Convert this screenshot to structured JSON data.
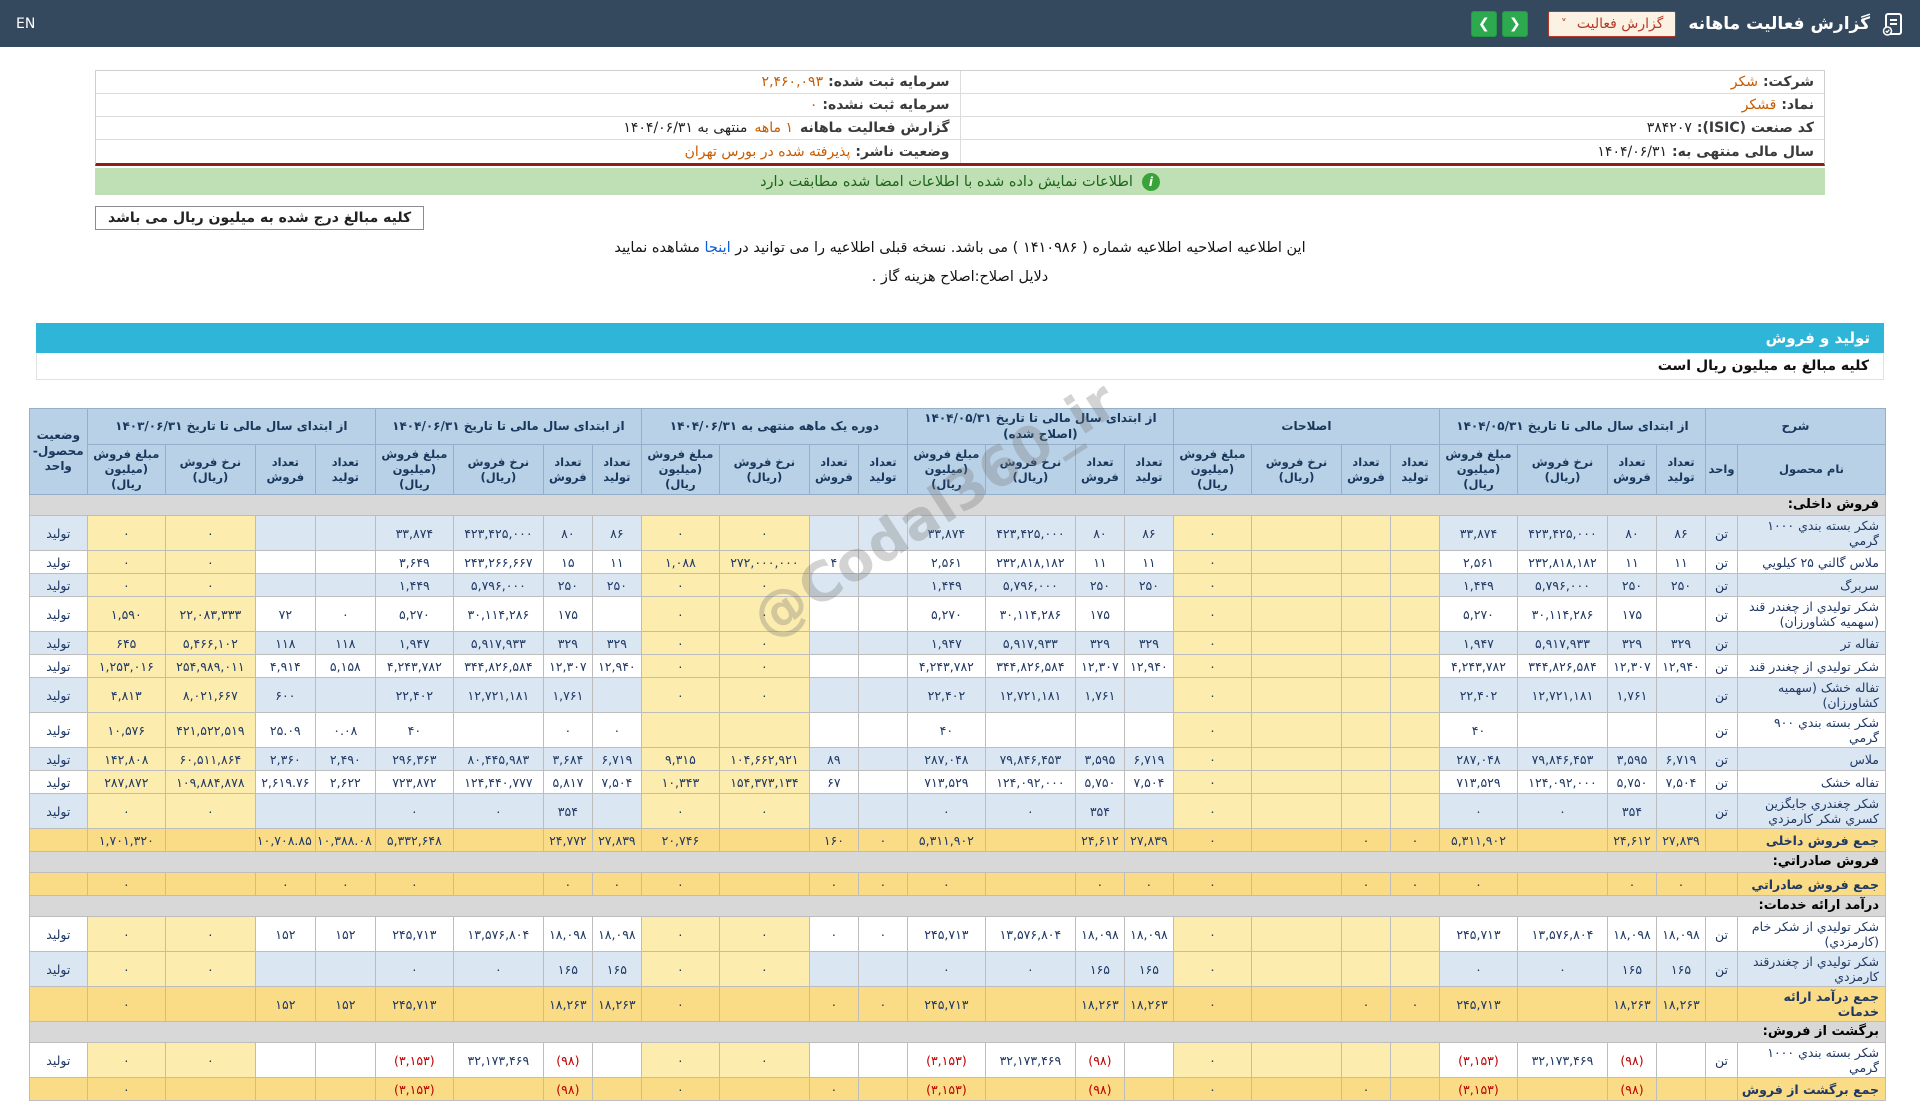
{
  "topbar": {
    "title": "گزارش فعالیت ماهانه",
    "dropdown_label": "گزارش فعالیت",
    "en": "EN",
    "icons": {
      "prev": "❮",
      "next": "❯",
      "caret": "˅",
      "info": "i"
    }
  },
  "info": {
    "company_label": "شرکت:",
    "company_value": "شکر",
    "symbol_label": "نماد:",
    "symbol_value": "قشکر",
    "isic_label": "کد صنعت (ISIC):",
    "isic_value": "۳۸۴۲۰۷",
    "fiscal_label": "سال مالی منتهی به:",
    "fiscal_value": "۱۴۰۴/۰۶/۳۱",
    "registered_capital_label": "سرمایه ثبت شده:",
    "registered_capital_value": "۲,۴۶۰,۰۹۳",
    "unregistered_capital_label": "سرمایه ثبت نشده:",
    "unregistered_capital_value": "۰",
    "report_period_label": "گزارش فعالیت ماهانه",
    "report_period_mid": "۱ ماهه",
    "report_period_tail": "منتهی به ۱۴۰۴/۰۶/۳۱",
    "issuer_status_label": "وضعیت ناشر:",
    "issuer_status_value": "پذیرفته شده در بورس تهران"
  },
  "banner": {
    "icon": "i",
    "text": "اطلاعات نمایش داده شده با اطلاعات امضا شده مطابقت دارد"
  },
  "amounts_box": "کلیه مبالغ درج شده به میلیون ریال می باشد",
  "notice": {
    "pre": "این اطلاعیه اصلاحیه اطلاعیه شماره ( ۱۴۱۰۹۸۶ ) می باشد. نسخه قبلی اطلاعیه را می توانید در",
    "link": "اینجا",
    "post": "مشاهده نمایید",
    "reason": "دلایل اصلاح:اصلاح هزینه گاز ."
  },
  "section": {
    "title": "تولید و فروش",
    "note": "کلیه مبالغ به میلیون ریال است"
  },
  "watermark": "@Codal360_ir",
  "table": {
    "corner": "شرح",
    "name_header": "نام محصول",
    "unit_header": "واحد",
    "status_header": "وضعیت محصول-واحد",
    "sub_labels": [
      "تعداد تولید",
      "تعداد فروش",
      "نرخ فروش (ریال)",
      "مبلغ فروش (میلیون ریال)"
    ],
    "groups": [
      "از ابتدای سال مالی تا تاریخ ۱۴۰۴/۰۵/۳۱",
      "اصلاحات",
      "از ابتدای سال مالی تا تاریخ ۱۴۰۴/۰۵/۳۱ (اصلاح شده)",
      "دوره یک ماهه منتهی به ۱۴۰۴/۰۶/۳۱",
      "از ابتدای سال مالی تا تاریخ ۱۴۰۴/۰۶/۳۱",
      "از ابتدای سال مالی تا تاریخ ۱۴۰۳/۰۶/۳۱"
    ],
    "rows": [
      {
        "type": "section",
        "label": "فروش داخلی:"
      },
      {
        "type": "product",
        "name": "شکر بسته بندي ۱۰۰۰ گرمي",
        "unit": "تن",
        "status": "تولید",
        "g1": [
          "۸۶",
          "۸۰",
          "۴۲۳,۴۲۵,۰۰۰",
          "۳۳,۸۷۴"
        ],
        "g2": [
          "",
          "",
          "",
          "۰"
        ],
        "g3": [
          "۸۶",
          "۸۰",
          "۴۲۳,۴۲۵,۰۰۰",
          "۳۳,۸۷۴"
        ],
        "g4": [
          "",
          "",
          "۰",
          "۰"
        ],
        "g5": [
          "۸۶",
          "۸۰",
          "۴۲۳,۴۲۵,۰۰۰",
          "۳۳,۸۷۴"
        ],
        "g6": [
          "",
          "",
          "۰",
          "۰"
        ]
      },
      {
        "type": "product",
        "name": "ملاس گالني ۲۵ کيلويي",
        "unit": "تن",
        "status": "تولید",
        "g1": [
          "۱۱",
          "۱۱",
          "۲۳۲,۸۱۸,۱۸۲",
          "۲,۵۶۱"
        ],
        "g2": [
          "",
          "",
          "",
          "۰"
        ],
        "g3": [
          "۱۱",
          "۱۱",
          "۲۳۲,۸۱۸,۱۸۲",
          "۲,۵۶۱"
        ],
        "g4": [
          "",
          "۴",
          "۲۷۲,۰۰۰,۰۰۰",
          "۱,۰۸۸"
        ],
        "g5": [
          "۱۱",
          "۱۵",
          "۲۴۳,۲۶۶,۶۶۷",
          "۳,۶۴۹"
        ],
        "g6": [
          "",
          "",
          "۰",
          "۰"
        ]
      },
      {
        "type": "product",
        "name": "سربرگ",
        "unit": "تن",
        "status": "تولید",
        "g1": [
          "۲۵۰",
          "۲۵۰",
          "۵,۷۹۶,۰۰۰",
          "۱,۴۴۹"
        ],
        "g2": [
          "",
          "",
          "",
          "۰"
        ],
        "g3": [
          "۲۵۰",
          "۲۵۰",
          "۵,۷۹۶,۰۰۰",
          "۱,۴۴۹"
        ],
        "g4": [
          "",
          "",
          "۰",
          "۰"
        ],
        "g5": [
          "۲۵۰",
          "۲۵۰",
          "۵,۷۹۶,۰۰۰",
          "۱,۴۴۹"
        ],
        "g6": [
          "",
          "",
          "۰",
          "۰"
        ]
      },
      {
        "type": "product",
        "name": "شکر توليدي از چغندر قند (سهميه کشاورزان)",
        "unit": "تن",
        "status": "تولید",
        "g1": [
          "",
          "۱۷۵",
          "۳۰,۱۱۴,۲۸۶",
          "۵,۲۷۰"
        ],
        "g2": [
          "",
          "",
          "",
          "۰"
        ],
        "g3": [
          "",
          "۱۷۵",
          "۳۰,۱۱۴,۲۸۶",
          "۵,۲۷۰"
        ],
        "g4": [
          "",
          "",
          "۰",
          "۰"
        ],
        "g5": [
          "",
          "۱۷۵",
          "۳۰,۱۱۴,۲۸۶",
          "۵,۲۷۰"
        ],
        "g6": [
          "۰",
          "۷۲",
          "۲۲,۰۸۳,۳۳۳",
          "۱,۵۹۰"
        ]
      },
      {
        "type": "product",
        "name": "تفاله تر",
        "unit": "تن",
        "status": "تولید",
        "g1": [
          "۳۲۹",
          "۳۲۹",
          "۵,۹۱۷,۹۳۳",
          "۱,۹۴۷"
        ],
        "g2": [
          "",
          "",
          "",
          "۰"
        ],
        "g3": [
          "۳۲۹",
          "۳۲۹",
          "۵,۹۱۷,۹۳۳",
          "۱,۹۴۷"
        ],
        "g4": [
          "",
          "",
          "۰",
          "۰"
        ],
        "g5": [
          "۳۲۹",
          "۳۲۹",
          "۵,۹۱۷,۹۳۳",
          "۱,۹۴۷"
        ],
        "g6": [
          "۱۱۸",
          "۱۱۸",
          "۵,۴۶۶,۱۰۲",
          "۶۴۵"
        ]
      },
      {
        "type": "product",
        "name": "شکر توليدي از چغندر قند",
        "unit": "تن",
        "status": "تولید",
        "g1": [
          "۱۲,۹۴۰",
          "۱۲,۳۰۷",
          "۳۴۴,۸۲۶,۵۸۴",
          "۴,۲۴۳,۷۸۲"
        ],
        "g2": [
          "",
          "",
          "",
          "۰"
        ],
        "g3": [
          "۱۲,۹۴۰",
          "۱۲,۳۰۷",
          "۳۴۴,۸۲۶,۵۸۴",
          "۴,۲۴۳,۷۸۲"
        ],
        "g4": [
          "",
          "",
          "۰",
          "۰"
        ],
        "g5": [
          "۱۲,۹۴۰",
          "۱۲,۳۰۷",
          "۳۴۴,۸۲۶,۵۸۴",
          "۴,۲۴۳,۷۸۲"
        ],
        "g6": [
          "۵,۱۵۸",
          "۴,۹۱۴",
          "۲۵۴,۹۸۹,۰۱۱",
          "۱,۲۵۳,۰۱۶"
        ]
      },
      {
        "type": "product",
        "name": "تفاله خشک (سهميه کشاورزان)",
        "unit": "تن",
        "status": "تولید",
        "g1": [
          "",
          "۱,۷۶۱",
          "۱۲,۷۲۱,۱۸۱",
          "۲۲,۴۰۲"
        ],
        "g2": [
          "",
          "",
          "",
          "۰"
        ],
        "g3": [
          "",
          "۱,۷۶۱",
          "۱۲,۷۲۱,۱۸۱",
          "۲۲,۴۰۲"
        ],
        "g4": [
          "",
          "",
          "۰",
          "۰"
        ],
        "g5": [
          "",
          "۱,۷۶۱",
          "۱۲,۷۲۱,۱۸۱",
          "۲۲,۴۰۲"
        ],
        "g6": [
          "",
          "۶۰۰",
          "۸,۰۲۱,۶۶۷",
          "۴,۸۱۳"
        ]
      },
      {
        "type": "product",
        "name": "شکر بسته بندي ۹۰۰ گرمي",
        "unit": "تن",
        "status": "تولید",
        "g1": [
          "",
          "",
          "",
          "۴۰"
        ],
        "g2": [
          "",
          "",
          "",
          "۰"
        ],
        "g3": [
          "",
          "",
          "",
          "۴۰"
        ],
        "g4": [
          "",
          "",
          "",
          ""
        ],
        "g5": [
          "۰",
          "۰",
          "",
          "۴۰"
        ],
        "g6": [
          "۰.۰۸",
          "۲۵.۰۹",
          "۴۲۱,۵۲۲,۵۱۹",
          "۱۰,۵۷۶"
        ]
      },
      {
        "type": "product",
        "name": "ملاس",
        "unit": "تن",
        "status": "تولید",
        "g1": [
          "۶,۷۱۹",
          "۳,۵۹۵",
          "۷۹,۸۴۶,۴۵۳",
          "۲۸۷,۰۴۸"
        ],
        "g2": [
          "",
          "",
          "",
          "۰"
        ],
        "g3": [
          "۶,۷۱۹",
          "۳,۵۹۵",
          "۷۹,۸۴۶,۴۵۳",
          "۲۸۷,۰۴۸"
        ],
        "g4": [
          "",
          "۸۹",
          "۱۰۴,۶۶۲,۹۲۱",
          "۹,۳۱۵"
        ],
        "g5": [
          "۶,۷۱۹",
          "۳,۶۸۴",
          "۸۰,۴۴۵,۹۸۳",
          "۲۹۶,۳۶۳"
        ],
        "g6": [
          "۲,۴۹۰",
          "۲,۳۶۰",
          "۶۰,۵۱۱,۸۶۴",
          "۱۴۲,۸۰۸"
        ]
      },
      {
        "type": "product",
        "name": "تفاله خشک",
        "unit": "تن",
        "status": "تولید",
        "g1": [
          "۷,۵۰۴",
          "۵,۷۵۰",
          "۱۲۴,۰۹۲,۰۰۰",
          "۷۱۳,۵۲۹"
        ],
        "g2": [
          "",
          "",
          "",
          "۰"
        ],
        "g3": [
          "۷,۵۰۴",
          "۵,۷۵۰",
          "۱۲۴,۰۹۲,۰۰۰",
          "۷۱۳,۵۲۹"
        ],
        "g4": [
          "",
          "۶۷",
          "۱۵۴,۳۷۳,۱۳۴",
          "۱۰,۳۴۳"
        ],
        "g5": [
          "۷,۵۰۴",
          "۵,۸۱۷",
          "۱۲۴,۴۴۰,۷۷۷",
          "۷۲۳,۸۷۲"
        ],
        "g6": [
          "۲,۶۲۲",
          "۲,۶۱۹.۷۶",
          "۱۰۹,۸۸۴,۸۷۸",
          "۲۸۷,۸۷۲"
        ]
      },
      {
        "type": "product",
        "name": "شکر چغندري جايگزين کسري شکر کارمزدي",
        "unit": "تن",
        "status": "تولید",
        "g1": [
          "",
          "۳۵۴",
          "۰",
          "۰"
        ],
        "g2": [
          "",
          "",
          "",
          "۰"
        ],
        "g3": [
          "",
          "۳۵۴",
          "۰",
          "۰"
        ],
        "g4": [
          "",
          "",
          "۰",
          "۰"
        ],
        "g5": [
          "",
          "۳۵۴",
          "۰",
          "۰"
        ],
        "g6": [
          "",
          "",
          "۰",
          "۰"
        ]
      },
      {
        "type": "total",
        "name": "جمع فروش داخلی",
        "g1": [
          "۲۷,۸۳۹",
          "۲۴,۶۱۲",
          "",
          "۵,۳۱۱,۹۰۲"
        ],
        "g2": [
          "۰",
          "۰",
          "",
          "۰"
        ],
        "g3": [
          "۲۷,۸۳۹",
          "۲۴,۶۱۲",
          "",
          "۵,۳۱۱,۹۰۲"
        ],
        "g4": [
          "۰",
          "۱۶۰",
          "",
          "۲۰,۷۴۶"
        ],
        "g5": [
          "۲۷,۸۳۹",
          "۲۴,۷۷۲",
          "",
          "۵,۳۳۲,۶۴۸"
        ],
        "g6": [
          "۱۰,۳۸۸.۰۸",
          "۱۰,۷۰۸.۸۵",
          "",
          "۱,۷۰۱,۳۲۰"
        ]
      },
      {
        "type": "section",
        "label": "فروش صادراتي:"
      },
      {
        "type": "total",
        "name": "جمع فروش صادراتي",
        "g1": [
          "۰",
          "۰",
          "",
          "۰"
        ],
        "g2": [
          "۰",
          "۰",
          "",
          "۰"
        ],
        "g3": [
          "۰",
          "۰",
          "",
          "۰"
        ],
        "g4": [
          "۰",
          "۰",
          "",
          "۰"
        ],
        "g5": [
          "۰",
          "۰",
          "",
          "۰"
        ],
        "g6": [
          "۰",
          "۰",
          "",
          "۰"
        ]
      },
      {
        "type": "section",
        "label": "درآمد ارائه خدمات:"
      },
      {
        "type": "product",
        "name": "شکر توليدي از شکر خام (کارمزدي)",
        "unit": "تن",
        "status": "تولید",
        "g1": [
          "۱۸,۰۹۸",
          "۱۸,۰۹۸",
          "۱۳,۵۷۶,۸۰۴",
          "۲۴۵,۷۱۳"
        ],
        "g2": [
          "",
          "",
          "",
          "۰"
        ],
        "g3": [
          "۱۸,۰۹۸",
          "۱۸,۰۹۸",
          "۱۳,۵۷۶,۸۰۴",
          "۲۴۵,۷۱۳"
        ],
        "g4": [
          "۰",
          "۰",
          "۰",
          "۰"
        ],
        "g5": [
          "۱۸,۰۹۸",
          "۱۸,۰۹۸",
          "۱۳,۵۷۶,۸۰۴",
          "۲۴۵,۷۱۳"
        ],
        "g6": [
          "۱۵۲",
          "۱۵۲",
          "۰",
          "۰"
        ]
      },
      {
        "type": "product",
        "name": "شکر توليدي از چغندرقند کارمزدي",
        "unit": "تن",
        "status": "تولید",
        "g1": [
          "۱۶۵",
          "۱۶۵",
          "۰",
          "۰"
        ],
        "g2": [
          "",
          "",
          "",
          "۰"
        ],
        "g3": [
          "۱۶۵",
          "۱۶۵",
          "۰",
          "۰"
        ],
        "g4": [
          "",
          "",
          "۰",
          "۰"
        ],
        "g5": [
          "۱۶۵",
          "۱۶۵",
          "۰",
          "۰"
        ],
        "g6": [
          "",
          "",
          "۰",
          "۰"
        ]
      },
      {
        "type": "total",
        "name": "جمع درآمد ارائه خدمات",
        "g1": [
          "۱۸,۲۶۳",
          "۱۸,۲۶۳",
          "",
          "۲۴۵,۷۱۳"
        ],
        "g2": [
          "۰",
          "۰",
          "",
          "۰"
        ],
        "g3": [
          "۱۸,۲۶۳",
          "۱۸,۲۶۳",
          "",
          "۲۴۵,۷۱۳"
        ],
        "g4": [
          "۰",
          "۰",
          "",
          "۰"
        ],
        "g5": [
          "۱۸,۲۶۳",
          "۱۸,۲۶۳",
          "",
          "۲۴۵,۷۱۳"
        ],
        "g6": [
          "۱۵۲",
          "۱۵۲",
          "",
          "۰"
        ]
      },
      {
        "type": "section",
        "label": "برگشت از فروش:"
      },
      {
        "type": "product",
        "name": "شکر بسته بندي ۱۰۰۰ گرمي",
        "unit": "تن",
        "status": "تولید",
        "g1": [
          "",
          "(۹۸)",
          "۳۲,۱۷۳,۴۶۹",
          "(۳,۱۵۳)"
        ],
        "g2": [
          "",
          "",
          "",
          "۰"
        ],
        "g3": [
          "",
          "(۹۸)",
          "۳۲,۱۷۳,۴۶۹",
          "(۳,۱۵۳)"
        ],
        "g4": [
          "",
          "",
          "۰",
          "۰"
        ],
        "g5": [
          "",
          "(۹۸)",
          "۳۲,۱۷۳,۴۶۹",
          "(۳,۱۵۳)"
        ],
        "g6": [
          "",
          "",
          "۰",
          "۰"
        ]
      },
      {
        "type": "total",
        "name": "جمع برگشت از فروش",
        "g1": [
          "",
          "(۹۸)",
          "",
          "(۳,۱۵۳)"
        ],
        "g2": [
          "",
          "۰",
          "",
          "۰"
        ],
        "g3": [
          "",
          "(۹۸)",
          "",
          "(۳,۱۵۳)"
        ],
        "g4": [
          "",
          "۰",
          "",
          "۰"
        ],
        "g5": [
          "",
          "(۹۸)",
          "",
          "(۳,۱۵۳)"
        ],
        "g6": [
          "",
          "",
          "",
          "۰"
        ]
      }
    ]
  }
}
